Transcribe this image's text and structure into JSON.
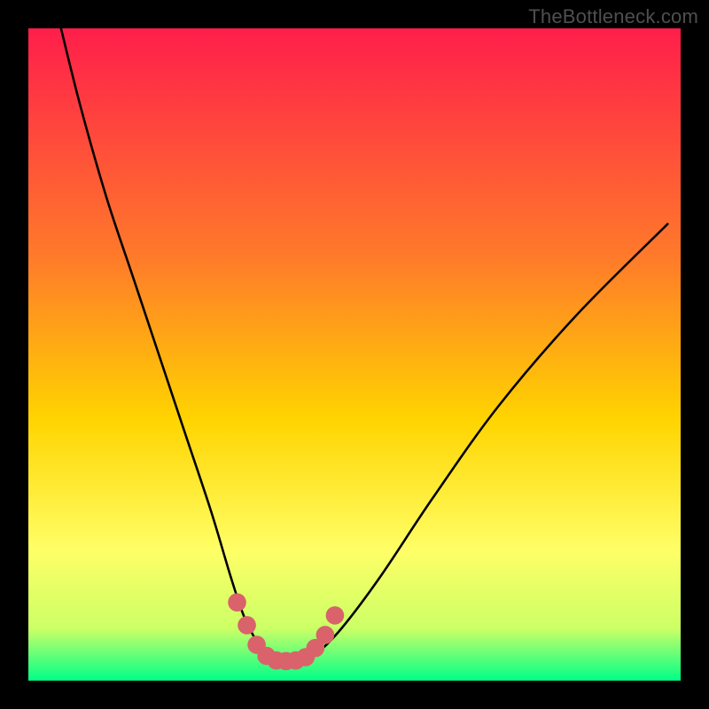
{
  "watermark": "TheBottleneck.com",
  "colors": {
    "bg": "#000000",
    "grad_top": "#ff1e4b",
    "grad_mid1": "#ff7a2a",
    "grad_mid2": "#ffd400",
    "grad_mid3": "#ffff66",
    "grad_mid4": "#ccff66",
    "grad_bottom": "#00ff88",
    "curve": "#000000",
    "points": "#d9626b"
  },
  "chart_data": {
    "type": "line",
    "title": "",
    "xlabel": "",
    "ylabel": "",
    "xlim": [
      0,
      100
    ],
    "ylim": [
      0,
      100
    ],
    "series": [
      {
        "name": "bottleneck-curve",
        "x": [
          5,
          8,
          12,
          16,
          20,
          24,
          28,
          31,
          33,
          35,
          36.5,
          38,
          40,
          42,
          44,
          48,
          54,
          62,
          72,
          84,
          98
        ],
        "y": [
          100,
          88,
          74,
          62,
          50,
          38,
          26,
          16,
          10,
          6,
          4,
          3.2,
          3,
          3.2,
          4,
          8,
          16,
          28,
          42,
          56,
          70
        ]
      }
    ],
    "highlight_points": {
      "name": "bottleneck-sweet-spot",
      "x": [
        32,
        33.5,
        35,
        36.5,
        38,
        39.5,
        41,
        42.5,
        44,
        45.5,
        47
      ],
      "y": [
        12,
        8.5,
        5.5,
        3.8,
        3.1,
        3,
        3.1,
        3.6,
        5,
        7,
        10
      ]
    }
  }
}
